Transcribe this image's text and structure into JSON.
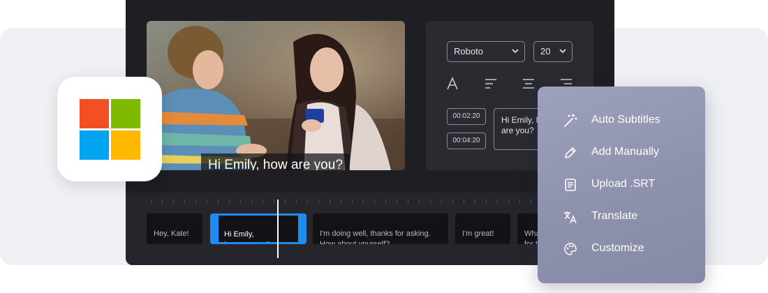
{
  "video": {
    "caption": "Hi Emily, how are you?"
  },
  "style_panel": {
    "font_select": "Roboto",
    "size_select": "20",
    "tools": [
      "text-style-icon",
      "align-left-icon",
      "align-center-icon",
      "align-right-icon"
    ],
    "time_start": "00:02:20",
    "time_end": "00:04:20",
    "subtitle_text": "Hi Emily, how\nare you?"
  },
  "timeline": {
    "clips": [
      "Hey, Kate!",
      "Hi Emily,\nhow are you?",
      "I'm doing well, thanks for asking.\nHow about yourself?",
      "I'm great!",
      "What\nfor t"
    ]
  },
  "logo": {
    "name": "microsoft-logo",
    "colors": [
      "#f25022",
      "#7fba00",
      "#00a4ef",
      "#ffb900"
    ]
  },
  "menu": {
    "items": [
      {
        "label": "Auto Subtitles",
        "icon": "magic-wand-icon"
      },
      {
        "label": "Add Manually",
        "icon": "pencil-icon"
      },
      {
        "label": "Upload .SRT",
        "icon": "document-icon"
      },
      {
        "label": "Translate",
        "icon": "translate-icon"
      },
      {
        "label": "Customize",
        "icon": "palette-icon"
      }
    ]
  },
  "colors": {
    "accent": "#1f8cf2",
    "editor_bg": "#1e1e23"
  }
}
